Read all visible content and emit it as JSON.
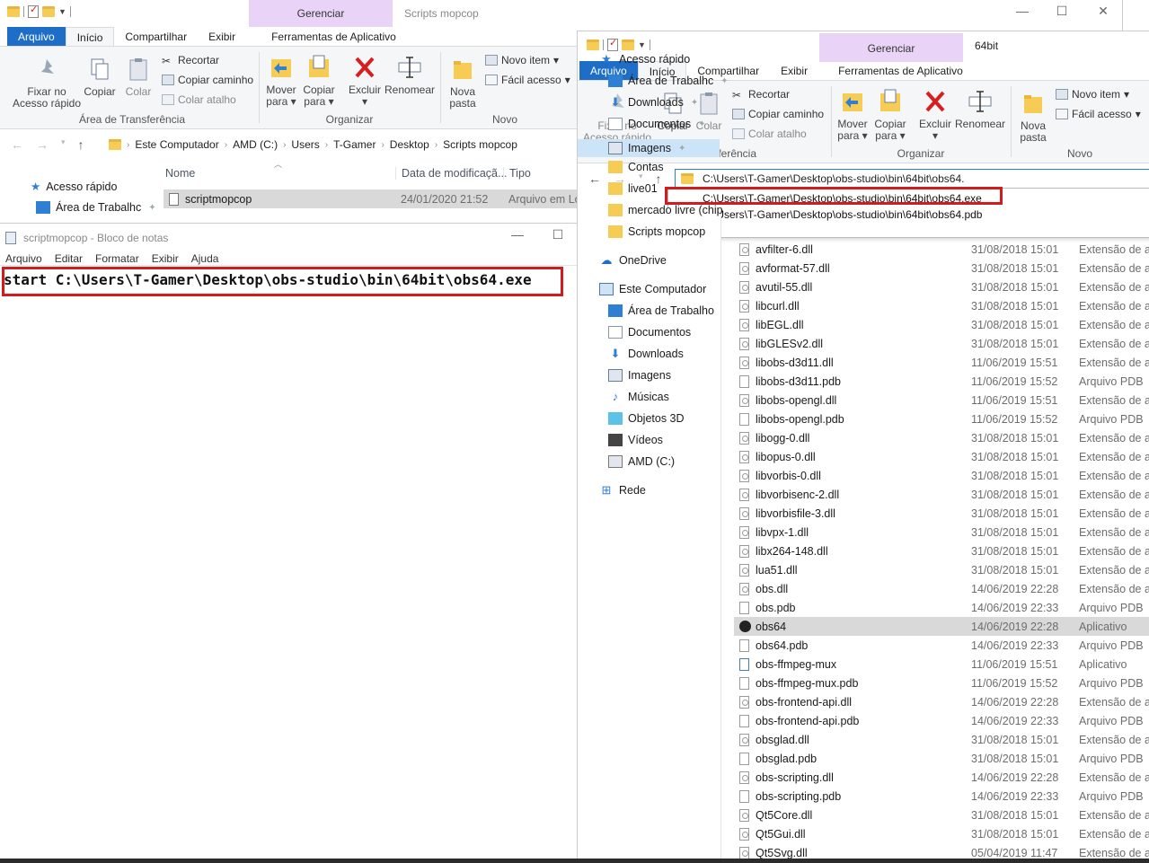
{
  "colors": {
    "accent": "#1e6ec8",
    "manage_band": "#e9d4f7",
    "highlight": "#d01c1c",
    "selected_row": "#d9d9d9"
  },
  "win1": {
    "title": "Scripts mopcop",
    "manage": "Gerenciar",
    "tabs": [
      "Arquivo",
      "Início",
      "Compartilhar",
      "Exibir",
      "Ferramentas de Aplicativo"
    ],
    "ribbon": {
      "pin": "Fixar no Acesso rápido",
      "copy": "Copiar",
      "paste": "Colar",
      "cut": "Recortar",
      "copy_path": "Copiar caminho",
      "paste_shortcut": "Colar atalho",
      "clipboard_group": "Área de Transferência",
      "move": "Mover para",
      "copy_to": "Copiar para",
      "delete": "Excluir",
      "rename": "Renomear",
      "organize_group": "Organizar",
      "new_folder": "Nova pasta",
      "new_item": "Novo item",
      "easy_access": "Fácil acesso",
      "new_group": "Novo"
    },
    "breadcrumb": [
      "Este Computador",
      "AMD (C:)",
      "Users",
      "T-Gamer",
      "Desktop",
      "Scripts mopcop"
    ],
    "columns": {
      "name": "Nome",
      "date": "Data de modificaçã...",
      "type": "Tipo"
    },
    "side": {
      "quick": "Acesso rápido",
      "desktop": "Área de Trabalhc"
    },
    "file": {
      "name": "scriptmopcop",
      "date": "24/01/2020 21:52",
      "type": "Arquivo em Lo"
    }
  },
  "notepad": {
    "title": "scriptmopcop - Bloco de notas",
    "menu": [
      "Arquivo",
      "Editar",
      "Formatar",
      "Exibir",
      "Ajuda"
    ],
    "text": "start C:\\Users\\T-Gamer\\Desktop\\obs-studio\\bin\\64bit\\obs64.exe"
  },
  "win2": {
    "title": "64bit",
    "manage": "Gerenciar",
    "tabs": [
      "Arquivo",
      "Início",
      "Compartilhar",
      "Exibir",
      "Ferramentas de Aplicativo"
    ],
    "ribbon": {
      "pin": "Fixar no Acesso rápido",
      "copy": "Copiar",
      "paste": "Colar",
      "cut": "Recortar",
      "copy_path": "Copiar caminho",
      "paste_shortcut": "Colar atalho",
      "clipboard_group": "Área de Transferência",
      "move": "Mover para",
      "copy_to": "Copiar para",
      "delete": "Excluir",
      "rename": "Renomear",
      "organize_group": "Organizar",
      "new_folder": "Nova pasta",
      "new_item": "Novo item",
      "easy_access": "Fácil acesso",
      "new_group": "Novo"
    },
    "address_value": "C:\\Users\\T-Gamer\\Desktop\\obs-studio\\bin\\64bit\\obs64.",
    "suggestions": [
      "C:\\Users\\T-Gamer\\Desktop\\obs-studio\\bin\\64bit\\obs64.exe",
      "C:\\Users\\T-Gamer\\Desktop\\obs-studio\\bin\\64bit\\obs64.pdb"
    ],
    "sidebar": [
      {
        "label": "Acesso rápido",
        "icon": "star-icon",
        "pin": false
      },
      {
        "label": "Área de Trabalhc",
        "icon": "desktop-icon",
        "pin": true
      },
      {
        "label": "Downloads",
        "icon": "download-icon",
        "pin": true
      },
      {
        "label": "Documentos",
        "icon": "documents-icon",
        "pin": true
      },
      {
        "label": "Imagens",
        "icon": "pictures-icon",
        "pin": true
      },
      {
        "label": "Contas",
        "icon": "folder-icon",
        "pin": false
      },
      {
        "label": "live01",
        "icon": "folder-icon",
        "pin": false
      },
      {
        "label": "mercado livre (chip",
        "icon": "folder-icon",
        "pin": false
      },
      {
        "label": "Scripts mopcop",
        "icon": "folder-icon",
        "pin": false
      },
      {
        "label": "OneDrive",
        "icon": "cloud-icon",
        "pin": false
      },
      {
        "label": "Este Computador",
        "icon": "computer-icon",
        "pin": false
      },
      {
        "label": "Área de Trabalho",
        "icon": "desktop-icon",
        "pin": false
      },
      {
        "label": "Documentos",
        "icon": "documents-icon",
        "pin": false
      },
      {
        "label": "Downloads",
        "icon": "download-icon",
        "pin": false
      },
      {
        "label": "Imagens",
        "icon": "pictures-icon",
        "pin": false
      },
      {
        "label": "Músicas",
        "icon": "music-icon",
        "pin": false
      },
      {
        "label": "Objetos 3D",
        "icon": "cube-icon",
        "pin": false
      },
      {
        "label": "Vídeos",
        "icon": "video-icon",
        "pin": false
      },
      {
        "label": "AMD (C:)",
        "icon": "drive-icon",
        "pin": false
      },
      {
        "label": "Rede",
        "icon": "network-icon",
        "pin": false
      }
    ],
    "files": [
      {
        "name": "avfilter-6.dll",
        "date": "31/08/2018 15:01",
        "type": "Extensão de ap",
        "kind": "dll"
      },
      {
        "name": "avformat-57.dll",
        "date": "31/08/2018 15:01",
        "type": "Extensão de ap",
        "kind": "dll"
      },
      {
        "name": "avutil-55.dll",
        "date": "31/08/2018 15:01",
        "type": "Extensão de ap",
        "kind": "dll"
      },
      {
        "name": "libcurl.dll",
        "date": "31/08/2018 15:01",
        "type": "Extensão de ap",
        "kind": "dll"
      },
      {
        "name": "libEGL.dll",
        "date": "31/08/2018 15:01",
        "type": "Extensão de ap",
        "kind": "dll"
      },
      {
        "name": "libGLESv2.dll",
        "date": "31/08/2018 15:01",
        "type": "Extensão de ap",
        "kind": "dll"
      },
      {
        "name": "libobs-d3d11.dll",
        "date": "11/06/2019 15:51",
        "type": "Extensão de ap",
        "kind": "dll"
      },
      {
        "name": "libobs-d3d11.pdb",
        "date": "11/06/2019 15:52",
        "type": "Arquivo PDB",
        "kind": "pdb"
      },
      {
        "name": "libobs-opengl.dll",
        "date": "11/06/2019 15:51",
        "type": "Extensão de ap",
        "kind": "dll"
      },
      {
        "name": "libobs-opengl.pdb",
        "date": "11/06/2019 15:52",
        "type": "Arquivo PDB",
        "kind": "pdb"
      },
      {
        "name": "libogg-0.dll",
        "date": "31/08/2018 15:01",
        "type": "Extensão de ap",
        "kind": "dll"
      },
      {
        "name": "libopus-0.dll",
        "date": "31/08/2018 15:01",
        "type": "Extensão de ap",
        "kind": "dll"
      },
      {
        "name": "libvorbis-0.dll",
        "date": "31/08/2018 15:01",
        "type": "Extensão de ap",
        "kind": "dll"
      },
      {
        "name": "libvorbisenc-2.dll",
        "date": "31/08/2018 15:01",
        "type": "Extensão de ap",
        "kind": "dll"
      },
      {
        "name": "libvorbisfile-3.dll",
        "date": "31/08/2018 15:01",
        "type": "Extensão de ap",
        "kind": "dll"
      },
      {
        "name": "libvpx-1.dll",
        "date": "31/08/2018 15:01",
        "type": "Extensão de ap",
        "kind": "dll"
      },
      {
        "name": "libx264-148.dll",
        "date": "31/08/2018 15:01",
        "type": "Extensão de ap",
        "kind": "dll"
      },
      {
        "name": "lua51.dll",
        "date": "31/08/2018 15:01",
        "type": "Extensão de ap",
        "kind": "dll"
      },
      {
        "name": "obs.dll",
        "date": "14/06/2019 22:28",
        "type": "Extensão de ap",
        "kind": "dll"
      },
      {
        "name": "obs.pdb",
        "date": "14/06/2019 22:33",
        "type": "Arquivo PDB",
        "kind": "pdb"
      },
      {
        "name": "obs64",
        "date": "14/06/2019 22:28",
        "type": "Aplicativo",
        "kind": "app",
        "selected": true
      },
      {
        "name": "obs64.pdb",
        "date": "14/06/2019 22:33",
        "type": "Arquivo PDB",
        "kind": "pdb"
      },
      {
        "name": "obs-ffmpeg-mux",
        "date": "11/06/2019 15:51",
        "type": "Aplicativo",
        "kind": "mux"
      },
      {
        "name": "obs-ffmpeg-mux.pdb",
        "date": "11/06/2019 15:52",
        "type": "Arquivo PDB",
        "kind": "pdb"
      },
      {
        "name": "obs-frontend-api.dll",
        "date": "14/06/2019 22:28",
        "type": "Extensão de ap",
        "kind": "dll"
      },
      {
        "name": "obs-frontend-api.pdb",
        "date": "14/06/2019 22:33",
        "type": "Arquivo PDB",
        "kind": "pdb"
      },
      {
        "name": "obsglad.dll",
        "date": "31/08/2018 15:01",
        "type": "Extensão de ap",
        "kind": "dll"
      },
      {
        "name": "obsglad.pdb",
        "date": "31/08/2018 15:01",
        "type": "Arquivo PDB",
        "kind": "pdb"
      },
      {
        "name": "obs-scripting.dll",
        "date": "14/06/2019 22:28",
        "type": "Extensão de ap",
        "kind": "dll"
      },
      {
        "name": "obs-scripting.pdb",
        "date": "14/06/2019 22:33",
        "type": "Arquivo PDB",
        "kind": "pdb"
      },
      {
        "name": "Qt5Core.dll",
        "date": "31/08/2018 15:01",
        "type": "Extensão de ap",
        "kind": "dll"
      },
      {
        "name": "Qt5Gui.dll",
        "date": "31/08/2018 15:01",
        "type": "Extensão de ap",
        "kind": "dll"
      },
      {
        "name": "Qt5Svg.dll",
        "date": "05/04/2019 11:47",
        "type": "Extensão de ap",
        "kind": "dll"
      }
    ]
  }
}
